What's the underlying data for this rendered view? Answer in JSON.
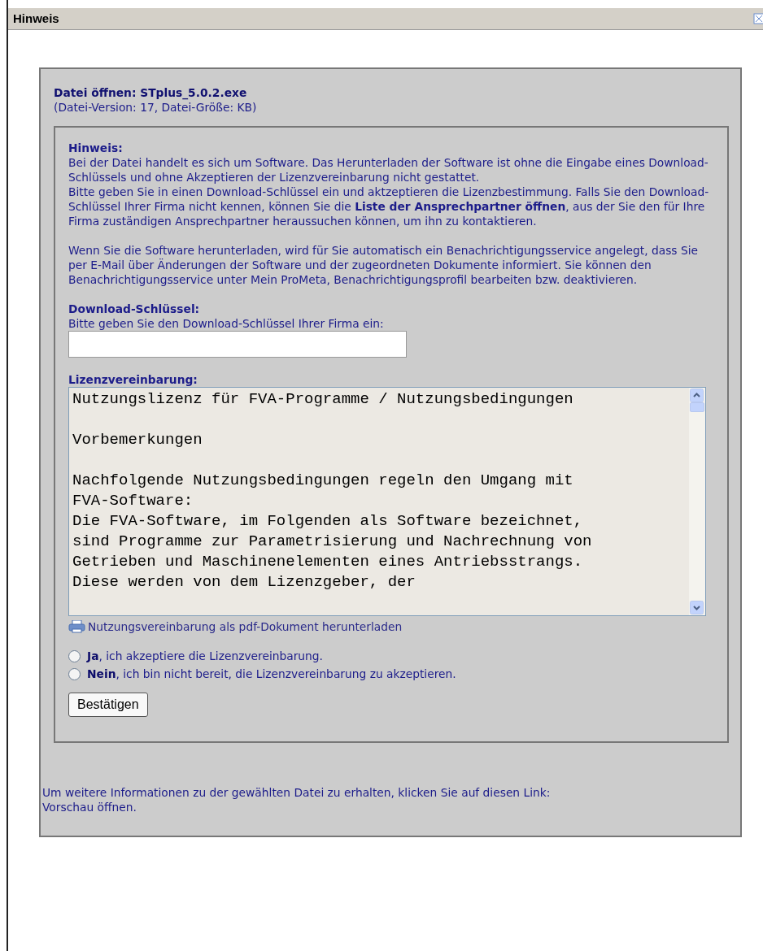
{
  "dialog": {
    "title": "Hinweis"
  },
  "file": {
    "heading": "Datei öffnen: STplus_5.0.2.exe",
    "meta": "(Datei-Version: 17, Datei-Größe: KB)"
  },
  "notice": {
    "heading": "Hinweis:",
    "paragraphs": [
      "Bei der Datei handelt es sich um Software. Das Herunterladen der Software ist ohne die Eingabe eines Download-Schlüssels und ohne Akzeptieren der Lizenzvereinbarung nicht gestattet.",
      "Bitte geben Sie in einen Download-Schlüssel ein und aktzeptieren die Lizenzbestimmung. Falls Sie den Download-Schlüssel Ihrer Firma nicht kennen, können Sie die **Liste der Ansprechpartner öffnen**, aus der Sie den für Ihre Firma zuständigen Ansprechpartner heraussuchen können, um ihn zu kontaktieren."
    ],
    "service": "Wenn Sie die Software herunterladen, wird für Sie automatisch ein Benachrichtigungsservice angelegt, dass Sie per E-Mail über Änderungen der Software und der zugeordneten Dokumente informiert. Sie können den Benachrichtigungsservice unter Mein ProMeta, Benachrichtigungsprofil bearbeiten bzw. deaktivieren."
  },
  "key": {
    "label": "Download-Schlüssel:",
    "hint": "Bitte geben Sie den Download-Schlüssel Ihrer Firma ein:"
  },
  "license": {
    "label": "Lizenzvereinbarung:",
    "blocks": [
      [
        "Nutzungslizenz für FVA-Programme / Nutzungsbedingungen"
      ],
      [
        "Vorbemerkungen"
      ],
      [
        "Nachfolgende Nutzungsbedingungen regeln den Umgang mit",
        "FVA-Software:",
        "Die FVA-Software, im Folgenden als Software bezeichnet,",
        "sind Programme zur Parametrisierung und Nachrechnung von",
        "Getrieben und Maschinenelementen eines Antriebsstrangs.",
        "Diese werden von dem Lizenzgeber, der"
      ]
    ],
    "pdf_link": "Nutzungsvereinbarung als pdf-Dokument herunterladen"
  },
  "options": [
    {
      "label": "**Ja**, ich akzeptiere die Lizenzvereinbarung.",
      "selected": false
    },
    {
      "label": "**Nein**, ich bin nicht bereit, die Lizenzvereinbarung zu akzeptieren.",
      "selected": false
    }
  ],
  "confirm_button": "Bestätigen",
  "footer": {
    "text": "Um weitere Informationen zu der gewählten Datei zu erhalten, klicken Sie auf diesen Link:",
    "link": "Vorschau öffnen."
  }
}
